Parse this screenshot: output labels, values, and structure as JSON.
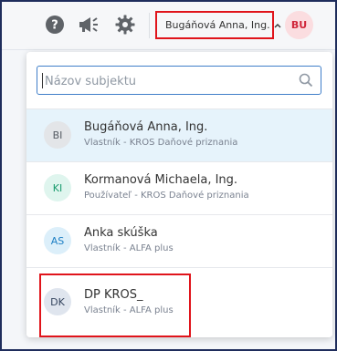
{
  "header": {
    "user_name": "Bugáňová Anna, Ing.",
    "avatar_initials": "BU",
    "icons": [
      "help-icon",
      "megaphone-icon",
      "gear-icon",
      "chevron-up-icon"
    ]
  },
  "dropdown": {
    "search": {
      "placeholder": "Názov subjektu",
      "value": ""
    },
    "items": [
      {
        "initials": "BI",
        "name": "Bugáňová Anna, Ing.",
        "subtitle": "Vlastník - KROS Daňové priznania",
        "avatar_bg": "#e3e5e8",
        "avatar_fg": "#555b63",
        "selected": true
      },
      {
        "initials": "KI",
        "name": "Kormanová Michaela, Ing.",
        "subtitle": "Používateľ - KROS Daňové priznania",
        "avatar_bg": "#dff5ee",
        "avatar_fg": "#1a9b6e",
        "selected": false
      },
      {
        "initials": "AS",
        "name": "Anka skúška",
        "subtitle": "Vlastník - ALFA plus",
        "avatar_bg": "#dceffa",
        "avatar_fg": "#1d7fc4",
        "selected": false
      },
      {
        "initials": "DK",
        "name": "DP KROS_",
        "subtitle": "Vlastník - ALFA plus",
        "avatar_bg": "#dfe5ee",
        "avatar_fg": "#34445e",
        "selected": false
      }
    ]
  },
  "colors": {
    "accent": "#3f7ec9",
    "highlight": "#e0141b",
    "selected_bg": "#e6f3fb"
  }
}
